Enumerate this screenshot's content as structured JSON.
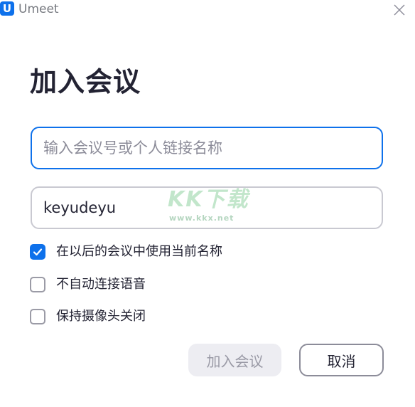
{
  "window": {
    "app_logo": "U",
    "app_name": "Umeet",
    "close_icon": "close-icon"
  },
  "page": {
    "title": "加入会议"
  },
  "form": {
    "meeting_id": {
      "value": "",
      "placeholder": "输入会议号或个人链接名称"
    },
    "display_name": {
      "value": "keyudeyu",
      "placeholder": ""
    }
  },
  "watermark": {
    "main": "KK下载",
    "sub": "www.kkx.net"
  },
  "options": [
    {
      "label": "在以后的会议中使用当前名称",
      "checked": true
    },
    {
      "label": "不自动连接语音",
      "checked": false
    },
    {
      "label": "保持摄像头关闭",
      "checked": false
    }
  ],
  "buttons": {
    "join": {
      "label": "加入会议",
      "enabled": false
    },
    "cancel": {
      "label": "取消"
    }
  },
  "colors": {
    "accent": "#0e71eb",
    "text": "#232333",
    "disabled_bg": "#ededf2",
    "disabled_text": "#9a9aa6"
  }
}
